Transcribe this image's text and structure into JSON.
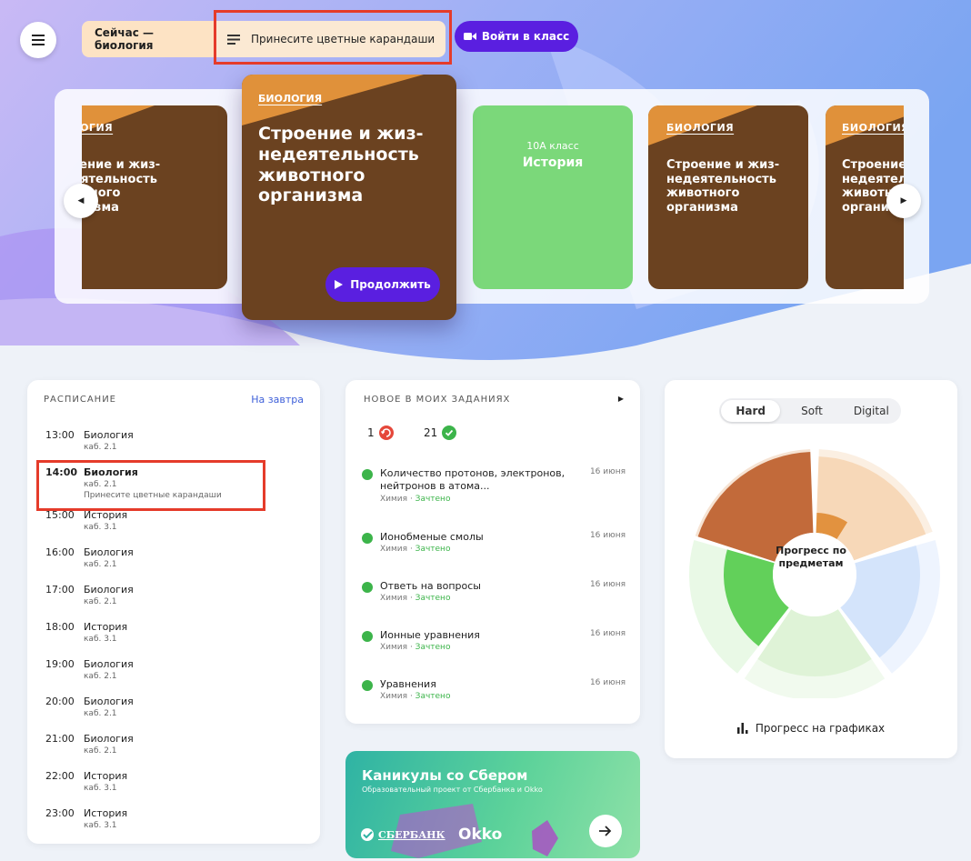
{
  "header": {
    "now_label": "Сейчас — биология",
    "note_label": "Принесите цветные карандаши",
    "join_label": "Войти в класс"
  },
  "carousel": {
    "featured": {
      "subject": "БИОЛОГИЯ",
      "title": "Строение и жиз-недеятельность животного организма",
      "continue_label": "Продолжить"
    },
    "left_card": {
      "subject": "БИОЛОГИЯ",
      "title": "Строение и жиз-недеятельность животного организма"
    },
    "class_card": {
      "class_label": "10А класс",
      "title": "История"
    },
    "right_card": {
      "subject": "БИОЛОГИЯ",
      "title": "Строение и жиз-недеятельность животного организма"
    },
    "edge_card": {
      "subject": "БИОЛОГИЯ",
      "title": "Строение и жиз-недеятельность животного организма"
    }
  },
  "schedule": {
    "heading": "РАСПИСАНИЕ",
    "tomorrow_link": "На завтра",
    "items": [
      {
        "time": "13:00",
        "subject": "Биология",
        "room": "каб. 2.1",
        "note": ""
      },
      {
        "time": "14:00",
        "subject": "Биология",
        "room": "каб. 2.1",
        "note": "Принесите цветные карандаши"
      },
      {
        "time": "15:00",
        "subject": "История",
        "room": "каб. 3.1",
        "note": ""
      },
      {
        "time": "16:00",
        "subject": "Биология",
        "room": "каб. 2.1",
        "note": ""
      },
      {
        "time": "17:00",
        "subject": "Биология",
        "room": "каб. 2.1",
        "note": ""
      },
      {
        "time": "18:00",
        "subject": "История",
        "room": "каб. 3.1",
        "note": ""
      },
      {
        "time": "19:00",
        "subject": "Биология",
        "room": "каб. 2.1",
        "note": ""
      },
      {
        "time": "20:00",
        "subject": "Биология",
        "room": "каб. 2.1",
        "note": ""
      },
      {
        "time": "21:00",
        "subject": "Биология",
        "room": "каб. 2.1",
        "note": ""
      },
      {
        "time": "22:00",
        "subject": "История",
        "room": "каб. 3.1",
        "note": ""
      },
      {
        "time": "23:00",
        "subject": "История",
        "room": "каб. 3.1",
        "note": ""
      }
    ]
  },
  "tasks": {
    "heading": "НОВОЕ В МОИХ ЗАДАНИЯХ",
    "overdue_count": "1",
    "done_count": "21",
    "items": [
      {
        "name": "Количество протонов, электронов, нейтронов в атома...",
        "date": "16 июня",
        "subject": "Химия",
        "status": "Зачтено"
      },
      {
        "name": "Ионобменые смолы",
        "date": "16 июня",
        "subject": "Химия",
        "status": "Зачтено"
      },
      {
        "name": "Ответь на вопросы",
        "date": "16 июня",
        "subject": "Химия",
        "status": "Зачтено"
      },
      {
        "name": "Ионные уравнения",
        "date": "16 июня",
        "subject": "Химия",
        "status": "Зачтено"
      },
      {
        "name": "Уравнения",
        "date": "16 июня",
        "subject": "Химия",
        "status": "Зачтено"
      }
    ]
  },
  "progress": {
    "tabs": [
      "Hard",
      "Soft",
      "Digital"
    ],
    "active_tab": "Hard",
    "center_label": "Прогресс по предметам",
    "link_label": "Прогресс на графиках",
    "colors": {
      "orange": "#c26a3a",
      "peach": "#f7d8b8",
      "blue": "#d4e4fb",
      "light_green": "#dff3d7",
      "green": "#62d05a"
    }
  },
  "promo": {
    "title": "Каникулы со Сбером",
    "subtitle": "Образовательный проект от Сбербанка и Okko",
    "sber_label": "СБЕРБАНК",
    "okko_label": "Okko"
  }
}
